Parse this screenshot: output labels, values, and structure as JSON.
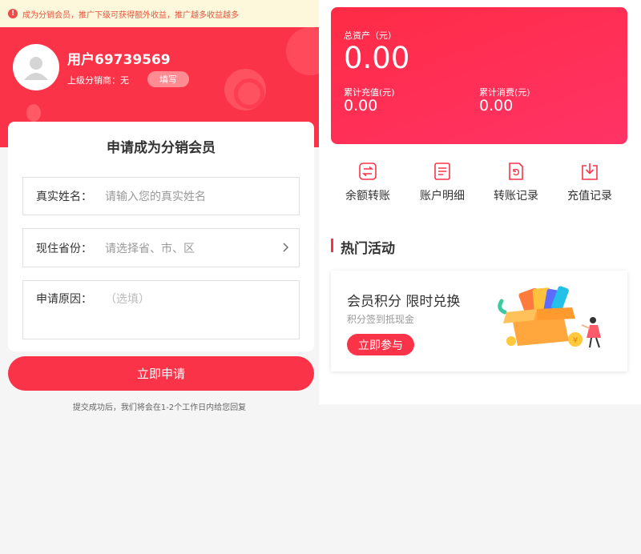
{
  "notice": {
    "text": "成为分销会员，推广下级可获得额外收益，推广越多收益越多"
  },
  "profile": {
    "username": "用户69739569",
    "parent_label": "上级分销商：无",
    "fill_button": "填写"
  },
  "form": {
    "title": "申请成为分销会员",
    "name_label": "真实姓名：",
    "name_placeholder": "请输入您的真实姓名",
    "province_label": "现住省份：",
    "province_placeholder": "请选择省、市、区",
    "reason_label": "申请原因：",
    "reason_placeholder": "（选填）",
    "submit": "立即申请",
    "tip": "提交成功后，我们将会在1-2个工作日内给您回复"
  },
  "assets": {
    "total_label": "总资产（元）",
    "total_value": "0.00",
    "recharge_label": "累计充值(元)",
    "recharge_value": "0.00",
    "consume_label": "累计消费(元)",
    "consume_value": "0.00"
  },
  "menu": [
    {
      "label": "余额转账",
      "icon": "transfer-icon"
    },
    {
      "label": "账户明细",
      "icon": "details-icon"
    },
    {
      "label": "转账记录",
      "icon": "record-icon"
    },
    {
      "label": "充值记录",
      "icon": "recharge-icon"
    }
  ],
  "hot": {
    "title": "热门活动",
    "promo_title": "会员积分 限时兑换",
    "promo_sub": "积分签到抵现金",
    "promo_button": "立即参与"
  },
  "colors": {
    "accent": "#fb3348",
    "notice_bg": "#fdf7dc"
  }
}
